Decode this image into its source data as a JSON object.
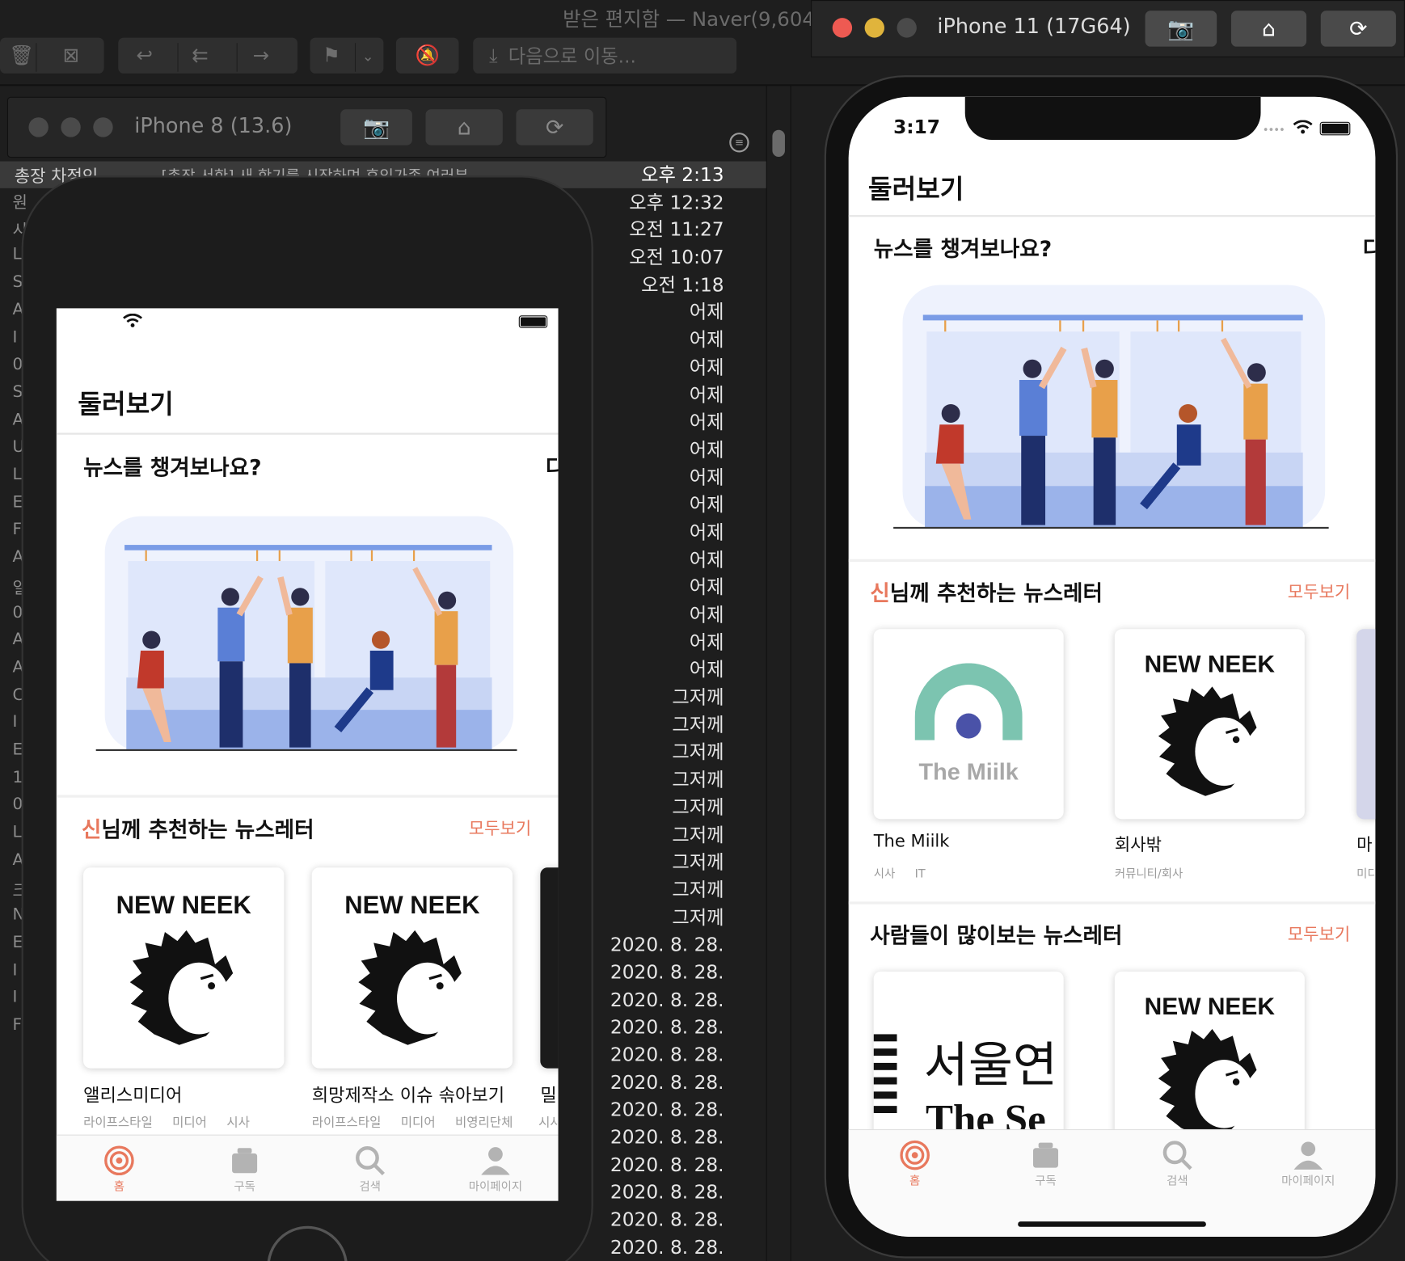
{
  "mail": {
    "window_title": "받은 편지함 — Naver(9,604",
    "move_placeholder": "다음으로 이동...",
    "selected_sender": "총장 차정인",
    "selected_subject": "[총장 서한] 새 학기를 시작하며 후임가족 여러분...",
    "dates": [
      "오후 2:13",
      "오후 12:32",
      "오전 11:27",
      "오전 10:07",
      "오전 1:18",
      "어제",
      "어제",
      "어제",
      "어제",
      "어제",
      "어제",
      "어제",
      "어제",
      "어제",
      "어제",
      "어제",
      "어제",
      "어제",
      "어제",
      "그저께",
      "그저께",
      "그저께",
      "그저께",
      "그저께",
      "그저께",
      "그저께",
      "그저께",
      "그저께",
      "2020. 8. 28.",
      "2020. 8. 28.",
      "2020. 8. 28.",
      "2020. 8. 28.",
      "2020. 8. 28.",
      "2020. 8. 28.",
      "2020. 8. 28.",
      "2020. 8. 28.",
      "2020. 8. 28.",
      "2020. 8. 28.",
      "2020. 8. 28.",
      "2020. 8. 28."
    ],
    "left_letters": [
      "원",
      "시",
      "L",
      "S",
      "A",
      "I",
      "0",
      "S",
      "A",
      "U",
      "L",
      "E",
      "F",
      "A",
      "일",
      "0",
      "A",
      "A",
      "C",
      "I",
      "E",
      "1",
      "0",
      "L",
      "A",
      "크",
      "N",
      "E",
      "I",
      "I",
      "F"
    ]
  },
  "sim_small": {
    "name": "iPhone 8 (13.6)"
  },
  "sim_large": {
    "name": "iPhone 11 (17G64)"
  },
  "app": {
    "time": "3:17",
    "title": "둘러보기",
    "banner_heading": "뉴스를 챙겨보나요?",
    "banner_edge": "다",
    "recommend": {
      "highlight": "신",
      "rest": "님께 추천하는 뉴스레터",
      "more": "모두보기"
    },
    "popular": {
      "title": "사람들이 많이보는 뉴스레터",
      "more": "모두보기"
    },
    "small_cards": [
      {
        "logo": "NEW NEEK",
        "name": "앨리스미디어",
        "tags": [
          "라이프스타일",
          "미디어",
          "시사"
        ]
      },
      {
        "logo": "NEW NEEK",
        "name": "희망제작소 이슈 솎아보기",
        "tags": [
          "라이프스타일",
          "미디어",
          "비영리단체"
        ]
      },
      {
        "name": "밀",
        "tags": [
          "시사"
        ]
      }
    ],
    "large_cards": [
      {
        "logo": "The Miilk",
        "name": "The Miilk",
        "tags": [
          "시사",
          "IT"
        ]
      },
      {
        "logo": "NEW NEEK",
        "name": "회사밖",
        "tags": [
          "커뮤니티/회사"
        ]
      },
      {
        "name": "마",
        "tags": [
          "미디"
        ]
      }
    ],
    "popular_cards": [
      {
        "logo_line1": "서울연",
        "logo_line2": "The Se"
      },
      {
        "logo": "NEW NEEK"
      }
    ],
    "tabs": [
      {
        "label": "홈",
        "icon": "radar-icon"
      },
      {
        "label": "구독",
        "icon": "inbox-icon"
      },
      {
        "label": "검색",
        "icon": "search-icon"
      },
      {
        "label": "마이페이지",
        "icon": "person-icon"
      }
    ]
  },
  "colors": {
    "accent": "#e8785d",
    "miilk_arc": "#7cc4b0",
    "miilk_dot": "#4a52a8"
  }
}
